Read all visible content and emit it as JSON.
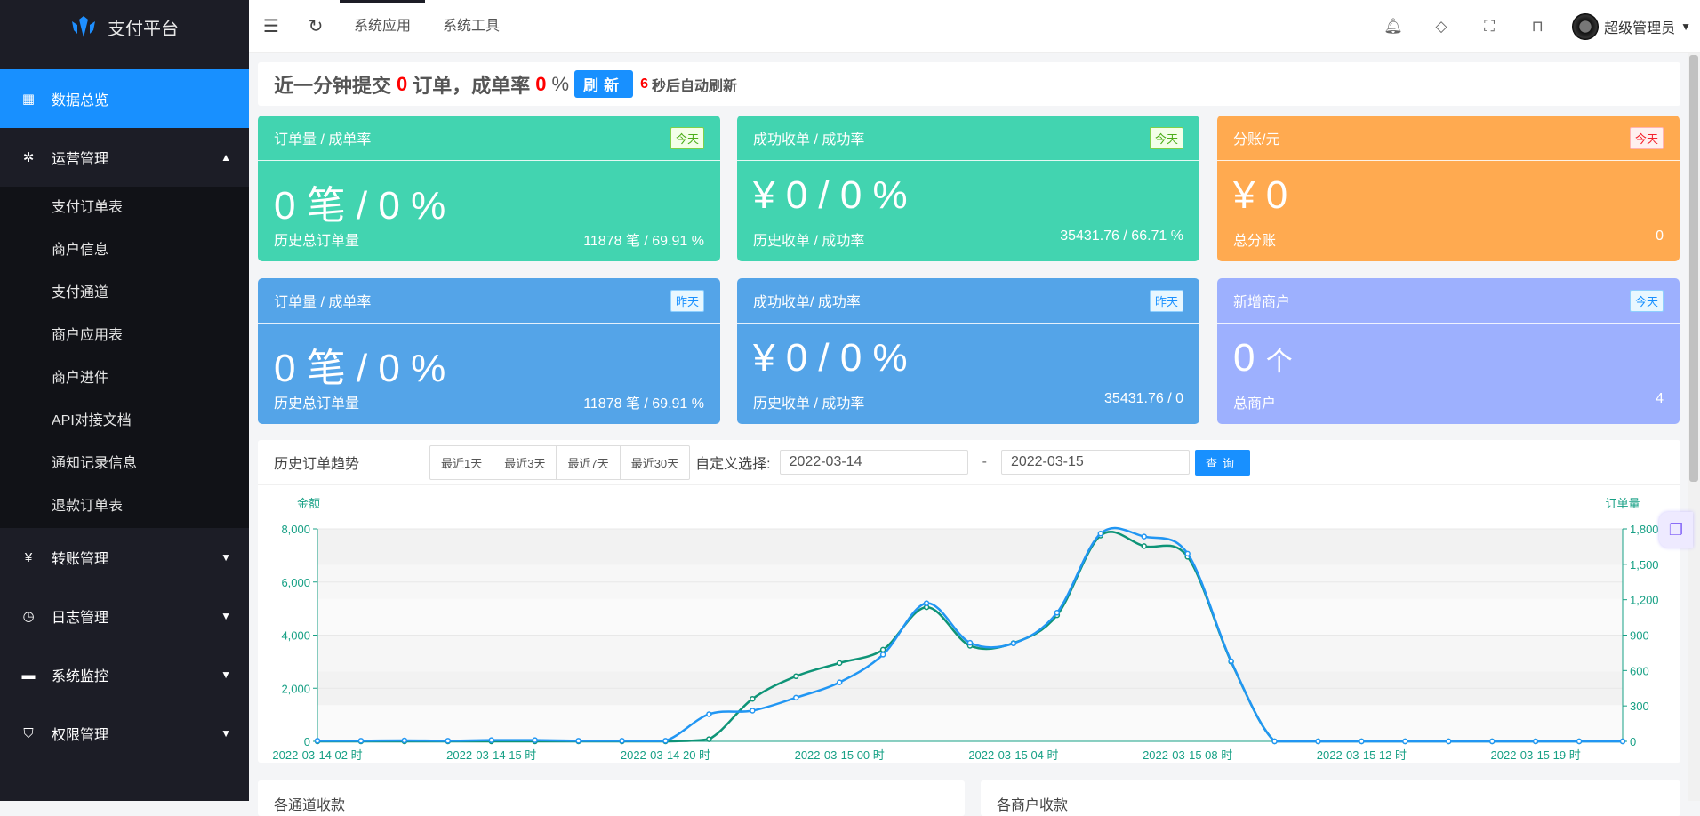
{
  "sidebar": {
    "brand": "支付平台",
    "items": [
      {
        "label": "数据总览",
        "icon": "dashboard-icon"
      },
      {
        "label": "运营管理",
        "icon": "settings-cog-icon"
      },
      {
        "label": "转账管理",
        "icon": "yen-icon"
      },
      {
        "label": "日志管理",
        "icon": "clock-icon"
      },
      {
        "label": "系统监控",
        "icon": "monitor-icon"
      },
      {
        "label": "权限管理",
        "icon": "shield-icon"
      }
    ],
    "submenu": [
      "支付订单表",
      "商户信息",
      "支付通道",
      "商户应用表",
      "商户进件",
      "API对接文档",
      "通知记录信息",
      "退款订单表"
    ]
  },
  "topbar": {
    "tabs": [
      "系统应用",
      "系统工具"
    ],
    "user": "超级管理员"
  },
  "notice": {
    "prefix": "近一分钟提交",
    "orders": "0",
    "mid": "订单，成单率",
    "rate": "0",
    "pct": "%",
    "refresh": "刷新",
    "countdown": "6",
    "suffix": "秒后自动刷新"
  },
  "cards": [
    {
      "title": "订单量 / 成单率",
      "tag": "今天",
      "big": "0 笔 / 0 %",
      "foot_label": "历史总订单量",
      "foot_value": "11878 笔 / 69.91 %"
    },
    {
      "title": "成功收单 / 成功率",
      "tag": "今天",
      "big": "¥ 0 / 0 %",
      "foot_label": "历史收单 / 成功率",
      "foot_value": "35431.76 / 66.71 %"
    },
    {
      "title": "分账/元",
      "tag": "今天",
      "big": "¥ 0",
      "foot_label": "总分账",
      "foot_value": "0"
    },
    {
      "title": "订单量 / 成单率",
      "tag": "昨天",
      "big": "0 笔 / 0 %",
      "foot_label": "历史总订单量",
      "foot_value": "11878 笔 / 69.91 %"
    },
    {
      "title": " 成功收单/ 成功率",
      "tag": "昨天",
      "big": "¥ 0 / 0 %",
      "foot_label": "历史收单 / 成功率",
      "foot_value": "35431.76 / 0"
    },
    {
      "title": "新增商户",
      "tag": "今天",
      "big": "0",
      "big_unit": "个",
      "foot_label": "总商户",
      "foot_value": "4"
    }
  ],
  "trend": {
    "title": "历史订单趋势",
    "ranges": [
      "最近1天",
      "最近3天",
      "最近7天",
      "最近30天"
    ],
    "custom_label": "自定义选择:",
    "start": "2022-03-14",
    "sep": "-",
    "end": "2022-03-15",
    "query": "查询"
  },
  "bottom": [
    "各通道收款",
    "各商户收款"
  ],
  "colors": {
    "green": "#42d4b0",
    "blue": "#54a4e8",
    "orange": "#ffaa50",
    "purple": "#9db0fe",
    "accent": "#1890ff",
    "amount_line": "#0e9477",
    "order_line": "#2196f3"
  },
  "chart_data": {
    "type": "line",
    "left_axis": {
      "name": "金额",
      "range": [
        0,
        8000
      ],
      "ticks": [
        "0",
        "2,000",
        "4,000",
        "6,000",
        "8,000"
      ]
    },
    "right_axis": {
      "name": "订单量",
      "range": [
        0,
        1800
      ],
      "ticks": [
        "0",
        "300",
        "600",
        "900",
        "1,200",
        "1,500",
        "1,800"
      ]
    },
    "x_labels": [
      {
        "index": 0,
        "text": "2022-03-14 02 时"
      },
      {
        "index": 4,
        "text": "2022-03-14 15 时"
      },
      {
        "index": 8,
        "text": "2022-03-14 20 时"
      },
      {
        "index": 12,
        "text": "2022-03-15 00 时"
      },
      {
        "index": 16,
        "text": "2022-03-15 04 时"
      },
      {
        "index": 20,
        "text": "2022-03-15 08 时"
      },
      {
        "index": 24,
        "text": "2022-03-15 12 时"
      },
      {
        "index": 28,
        "text": "2022-03-15 19 时"
      }
    ],
    "point_count": 31,
    "series": [
      {
        "name": "金额",
        "axis": "left",
        "values": [
          0,
          0,
          0,
          0,
          0,
          0,
          0,
          0,
          0,
          80,
          1600,
          2450,
          2950,
          3450,
          5050,
          3600,
          3700,
          4750,
          7750,
          7350,
          6950,
          3000,
          0,
          0,
          0,
          0,
          0,
          0,
          0,
          0,
          0
        ]
      },
      {
        "name": "订单量",
        "axis": "right",
        "values": [
          5,
          5,
          8,
          5,
          10,
          10,
          5,
          5,
          5,
          230,
          260,
          370,
          500,
          735,
          1170,
          835,
          830,
          1090,
          1760,
          1735,
          1590,
          680,
          0,
          0,
          0,
          0,
          0,
          0,
          0,
          0,
          0
        ]
      }
    ]
  }
}
